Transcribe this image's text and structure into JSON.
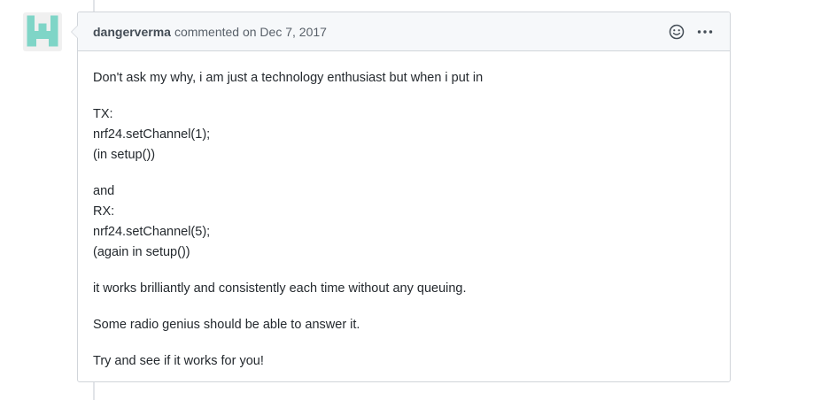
{
  "comment": {
    "author": "dangerverma",
    "meta": "commented on Dec 7, 2017",
    "body": {
      "p1": "Don't ask my why, i am just a technology enthusiast but when i put in",
      "tx_lines": [
        "TX:",
        "nrf24.setChannel(1);",
        "(in setup())"
      ],
      "rx_lines": [
        "and",
        "RX:",
        "nrf24.setChannel(5);",
        "(again in setup())"
      ],
      "p4": "it works brilliantly and consistently each time without any queuing.",
      "p5": "Some radio genius should be able to answer it.",
      "p6": "Try and see if it works for you!"
    }
  },
  "icons": {
    "reaction": "smiley-icon",
    "more": "kebab-horizontal-icon"
  },
  "colors": {
    "avatar": "#7fd5c7",
    "border": "#d1d5da",
    "header_bg": "#f6f8fa"
  }
}
